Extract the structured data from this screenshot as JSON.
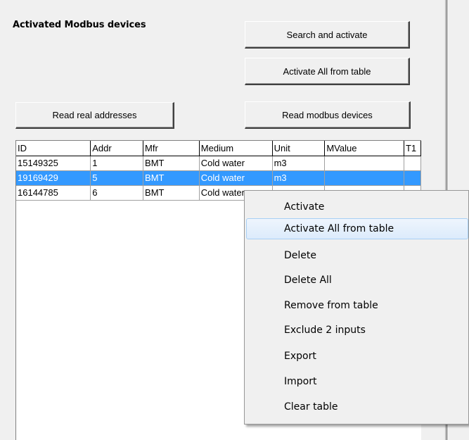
{
  "panel": {
    "title": "Activated Modbus devices"
  },
  "buttons": {
    "search_activate": "Search and activate",
    "activate_all": "Activate All from table",
    "read_real": "Read real addresses",
    "read_modbus": "Read modbus devices"
  },
  "grid": {
    "columns": [
      "ID",
      "Addr",
      "Mfr",
      "Medium",
      "Unit",
      "MValue",
      "T1"
    ],
    "rows": [
      {
        "id": "15149325",
        "addr": "1",
        "mfr": "BMT",
        "medium": "Cold water",
        "unit": "m3",
        "mvalue": "",
        "t1": ""
      },
      {
        "id": "19169429",
        "addr": "5",
        "mfr": "BMT",
        "medium": "Cold water",
        "unit": "m3",
        "mvalue": "",
        "t1": ""
      },
      {
        "id": "16144785",
        "addr": "6",
        "mfr": "BMT",
        "medium": "Cold water",
        "unit": "",
        "mvalue": "",
        "t1": ""
      }
    ],
    "selected_row": 1
  },
  "context_menu": {
    "items": [
      "Activate",
      "Activate All from table",
      "Delete",
      "Delete All",
      "Remove from table",
      "Exclude 2 inputs",
      "Export",
      "Import",
      "Clear table"
    ],
    "hovered_item": 1
  },
  "colors": {
    "selection": "#3399ff",
    "menu_hover_border": "#a8d0f5"
  }
}
